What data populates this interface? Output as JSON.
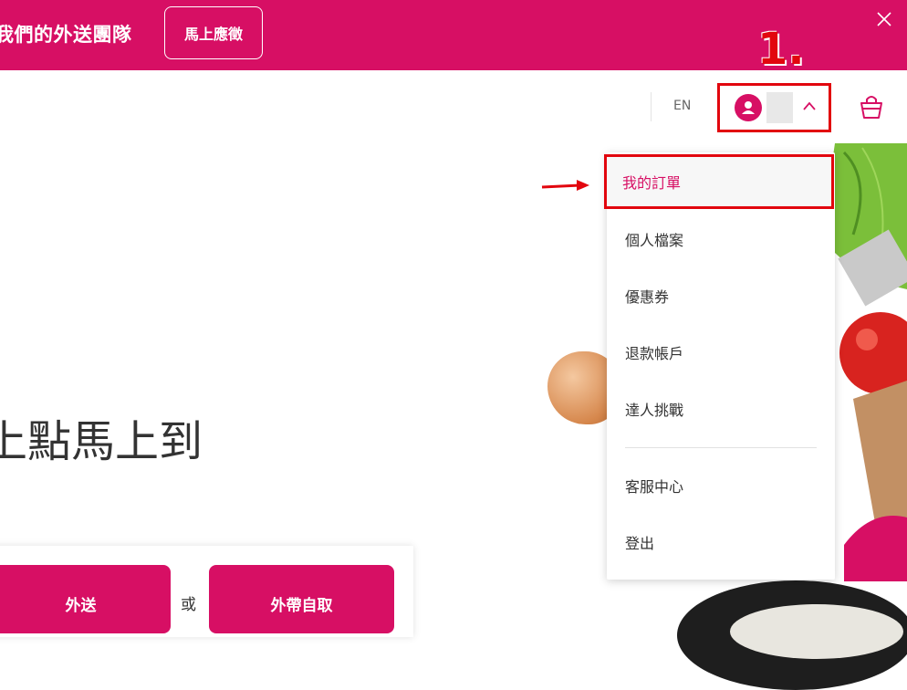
{
  "banner": {
    "text": "我們的外送團隊",
    "cta_label": "馬上應徵"
  },
  "header": {
    "lang_label": "EN"
  },
  "annotation": {
    "step_label": "1."
  },
  "dropdown": {
    "items": [
      {
        "label": "我的訂單",
        "active": true
      },
      {
        "label": "個人檔案"
      },
      {
        "label": "優惠券"
      },
      {
        "label": "退款帳戶"
      },
      {
        "label": "達人挑戰"
      },
      {
        "label": "客服中心"
      },
      {
        "label": "登出"
      }
    ]
  },
  "hero": {
    "title": "上點馬上到"
  },
  "search_card": {
    "delivery_label": "外送",
    "or_label": "或",
    "pickup_label": "外帶自取"
  },
  "colors": {
    "brand": "#d70f64",
    "annotation_red": "#e2060e"
  },
  "icons": [
    "close-icon",
    "user-icon",
    "chevron-up-icon",
    "cart-icon",
    "arrow-right-icon"
  ]
}
